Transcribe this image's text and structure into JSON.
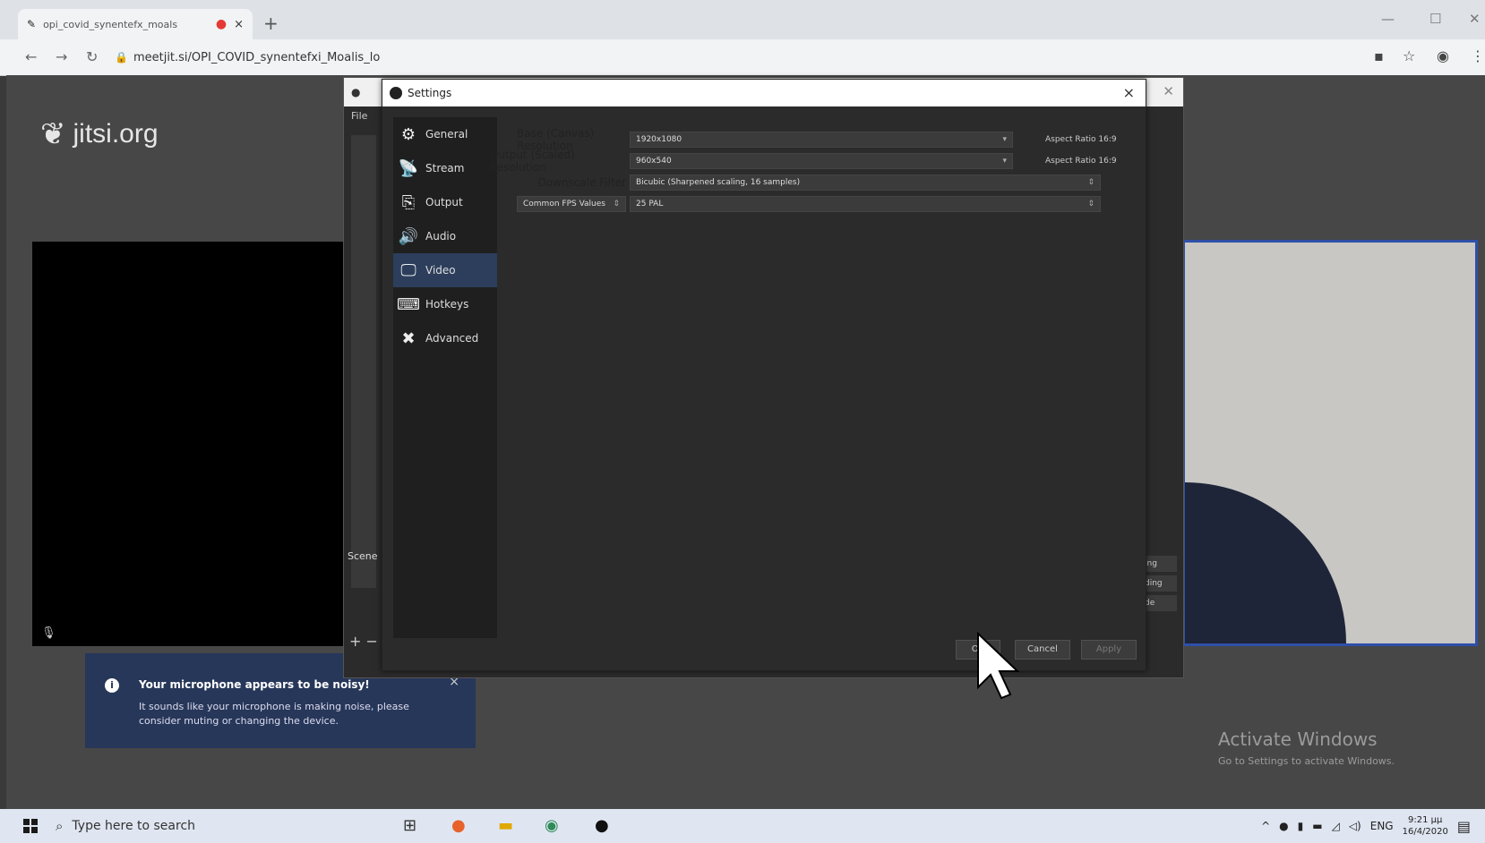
{
  "browser": {
    "tab_title": "opi_covid_synentefx_moals",
    "tab_close": "×",
    "new_tab": "+",
    "url": "meetjit.si/OPI_COVID_synentefxi_Moalis_lo",
    "win_min": "—",
    "win_max": "☐",
    "win_close": "✕"
  },
  "page": {
    "logo_text": "jitsi.org",
    "notification": {
      "title": "Your microphone appears to be noisy!",
      "body": "It sounds like your microphone is making noise, please consider muting or changing the device.",
      "close": "×"
    },
    "activate_title": "Activate Windows",
    "activate_sub": "Go to Settings to activate Windows."
  },
  "obs": {
    "file_menu": "File",
    "scene_label": "Scene",
    "plus": "+ −",
    "right_buttons": [
      "ing",
      "ding",
      "de"
    ]
  },
  "settings": {
    "title": "Settings",
    "close": "×",
    "sidebar": [
      {
        "label": "General",
        "icon": "gear-icon",
        "glyph": "⚙"
      },
      {
        "label": "Stream",
        "icon": "antenna-icon",
        "glyph": "📡"
      },
      {
        "label": "Output",
        "icon": "output-icon",
        "glyph": "⎘"
      },
      {
        "label": "Audio",
        "icon": "speaker-icon",
        "glyph": "🔊"
      },
      {
        "label": "Video",
        "icon": "monitor-icon",
        "glyph": "🖵"
      },
      {
        "label": "Hotkeys",
        "icon": "keyboard-icon",
        "glyph": "⌨"
      },
      {
        "label": "Advanced",
        "icon": "tools-icon",
        "glyph": "✖"
      }
    ],
    "active_item": "Video",
    "fields": {
      "base_label": "Base (Canvas) Resolution",
      "base_value": "1920x1080",
      "base_aspect": "Aspect Ratio 16:9",
      "output_label": "Output (Scaled) Resolution",
      "output_value": "960x540",
      "output_aspect": "Aspect Ratio 16:9",
      "filter_label": "Downscale Filter",
      "filter_value": "Bicubic (Sharpened scaling, 16 samples)",
      "fps_label": "Common FPS Values",
      "fps_value": "25 PAL"
    },
    "buttons": {
      "ok": "OK",
      "cancel": "Cancel",
      "apply": "Apply"
    }
  },
  "taskbar": {
    "search_placeholder": "Type here to search",
    "lang": "ENG",
    "time": "9:21 μμ",
    "date": "16/4/2020"
  }
}
